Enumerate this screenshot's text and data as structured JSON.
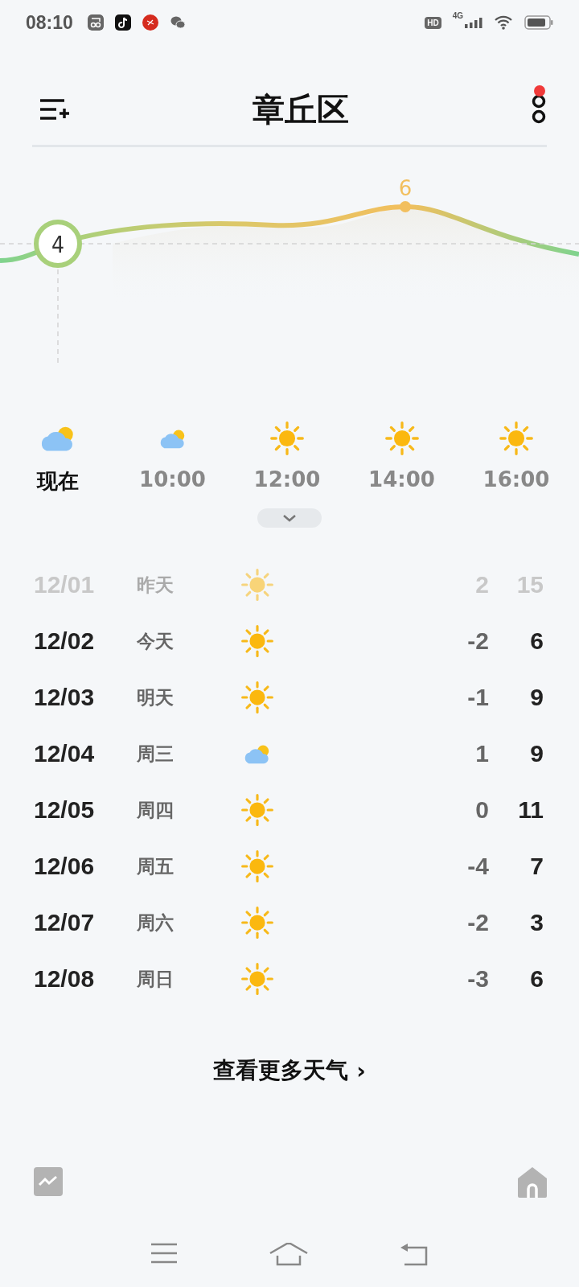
{
  "status_bar": {
    "time": "08:10",
    "hd_badge": "HD",
    "network": "4G"
  },
  "header": {
    "title": "章丘区",
    "has_notification": true
  },
  "temperature_curve": {
    "current": "4",
    "peak": "6"
  },
  "hourly": [
    {
      "label": "现在",
      "kind": "cloudy",
      "selected": true
    },
    {
      "label": "10:00",
      "kind": "cloudy",
      "selected": false
    },
    {
      "label": "12:00",
      "kind": "sunny",
      "selected": false
    },
    {
      "label": "14:00",
      "kind": "sunny",
      "selected": false
    },
    {
      "label": "16:00",
      "kind": "sunny",
      "selected": false
    }
  ],
  "daily": [
    {
      "date": "12/01",
      "day": "昨天",
      "kind": "sunny",
      "low": "2",
      "high": "15",
      "past": true
    },
    {
      "date": "12/02",
      "day": "今天",
      "kind": "sunny",
      "low": "-2",
      "high": "6",
      "past": false
    },
    {
      "date": "12/03",
      "day": "明天",
      "kind": "sunny",
      "low": "-1",
      "high": "9",
      "past": false
    },
    {
      "date": "12/04",
      "day": "周三",
      "kind": "cloudy",
      "low": "1",
      "high": "9",
      "past": false
    },
    {
      "date": "12/05",
      "day": "周四",
      "kind": "sunny",
      "low": "0",
      "high": "11",
      "past": false
    },
    {
      "date": "12/06",
      "day": "周五",
      "kind": "sunny",
      "low": "-4",
      "high": "7",
      "past": false
    },
    {
      "date": "12/07",
      "day": "周六",
      "kind": "sunny",
      "low": "-2",
      "high": "3",
      "past": false
    },
    {
      "date": "12/08",
      "day": "周日",
      "kind": "sunny",
      "low": "-3",
      "high": "6",
      "past": false
    }
  ],
  "more_link": {
    "label": "查看更多天气",
    "chevron": "›"
  }
}
